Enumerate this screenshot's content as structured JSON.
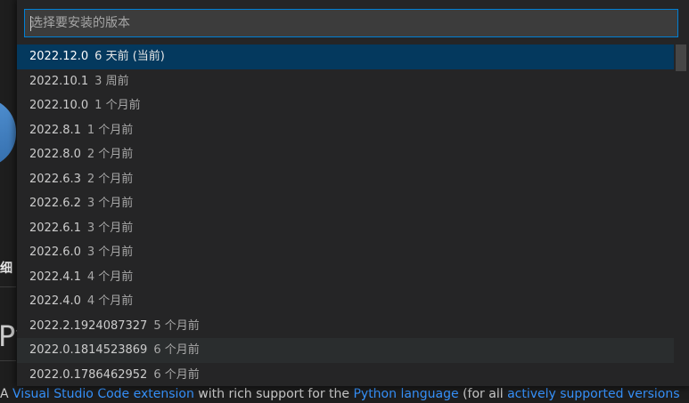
{
  "background": {
    "section_label": "细",
    "heading_fragment": "Py",
    "description": {
      "prefix": "A ",
      "link1": "Visual Studio Code extension",
      "middle": " with rich support for the ",
      "link2": "Python language",
      "middle2": " (for all ",
      "link3": "actively supported versions"
    },
    "chevron": "˅"
  },
  "quick_pick": {
    "placeholder": "选择要安装的版本",
    "items": [
      {
        "version": "2022.12.0",
        "age": "6 天前 (当前)"
      },
      {
        "version": "2022.10.1",
        "age": "3 周前"
      },
      {
        "version": "2022.10.0",
        "age": "1 个月前"
      },
      {
        "version": "2022.8.1",
        "age": "1 个月前"
      },
      {
        "version": "2022.8.0",
        "age": "2 个月前"
      },
      {
        "version": "2022.6.3",
        "age": "2 个月前"
      },
      {
        "version": "2022.6.2",
        "age": "3 个月前"
      },
      {
        "version": "2022.6.1",
        "age": "3 个月前"
      },
      {
        "version": "2022.6.0",
        "age": "3 个月前"
      },
      {
        "version": "2022.4.1",
        "age": "4 个月前"
      },
      {
        "version": "2022.4.0",
        "age": "4 个月前"
      },
      {
        "version": "2022.2.1924087327",
        "age": "5 个月前"
      },
      {
        "version": "2022.0.1814523869",
        "age": "6 个月前"
      },
      {
        "version": "2022.0.1786462952",
        "age": "6 个月前"
      }
    ]
  },
  "colors": {
    "accent_border": "#007fd4",
    "selected_row": "#04395e",
    "link": "#3794ff"
  }
}
